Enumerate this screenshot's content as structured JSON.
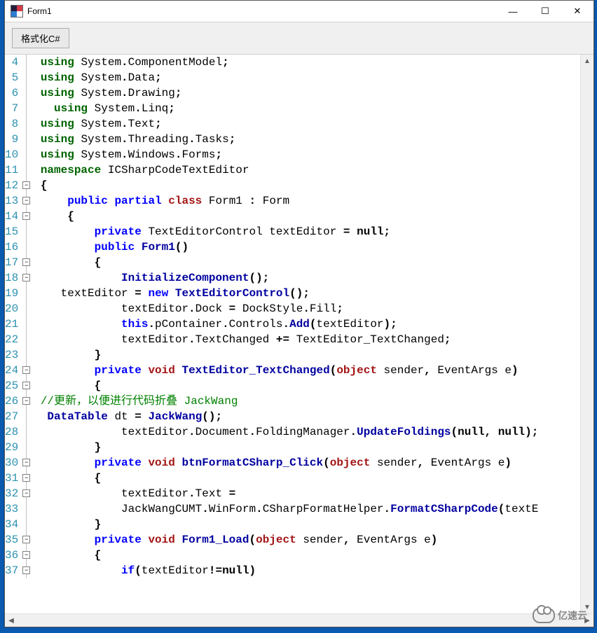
{
  "window": {
    "title": "Form1",
    "controls": {
      "minimize": "—",
      "maximize": "☐",
      "close": "✕"
    }
  },
  "toolbar": {
    "format_button": "格式化C#"
  },
  "editor": {
    "first_line_number": 4,
    "fold_marks": {
      "12": "-",
      "13": "-",
      "14": "-",
      "17": "-",
      "18": "-",
      "24": "-",
      "25": "-",
      "26": "-",
      "30": "-",
      "31": "-",
      "32": "-",
      "35": "-",
      "36": "-",
      "37": "-"
    },
    "lines": [
      {
        "n": 4,
        "t": [
          [
            "kw2",
            "using"
          ],
          [
            "sp",
            " "
          ],
          [
            "id",
            "System"
          ],
          [
            "punct",
            "."
          ],
          [
            "id",
            "ComponentModel"
          ],
          [
            "punct",
            ";"
          ]
        ]
      },
      {
        "n": 5,
        "t": [
          [
            "kw2",
            "using"
          ],
          [
            "sp",
            " "
          ],
          [
            "id",
            "System"
          ],
          [
            "punct",
            "."
          ],
          [
            "id",
            "Data"
          ],
          [
            "punct",
            ";"
          ]
        ]
      },
      {
        "n": 6,
        "t": [
          [
            "kw2",
            "using"
          ],
          [
            "sp",
            " "
          ],
          [
            "id",
            "System"
          ],
          [
            "punct",
            "."
          ],
          [
            "id",
            "Drawing"
          ],
          [
            "punct",
            ";"
          ]
        ]
      },
      {
        "n": 7,
        "t": [
          [
            "sp",
            "  "
          ],
          [
            "kw2",
            "using"
          ],
          [
            "sp",
            " "
          ],
          [
            "id",
            "System"
          ],
          [
            "punct",
            "."
          ],
          [
            "id",
            "Linq"
          ],
          [
            "punct",
            ";"
          ]
        ]
      },
      {
        "n": 8,
        "t": [
          [
            "kw2",
            "using"
          ],
          [
            "sp",
            " "
          ],
          [
            "id",
            "System"
          ],
          [
            "punct",
            "."
          ],
          [
            "id",
            "Text"
          ],
          [
            "punct",
            ";"
          ]
        ]
      },
      {
        "n": 9,
        "t": [
          [
            "kw2",
            "using"
          ],
          [
            "sp",
            " "
          ],
          [
            "id",
            "System"
          ],
          [
            "punct",
            "."
          ],
          [
            "id",
            "Threading"
          ],
          [
            "punct",
            "."
          ],
          [
            "id",
            "Tasks"
          ],
          [
            "punct",
            ";"
          ]
        ]
      },
      {
        "n": 10,
        "t": [
          [
            "kw2",
            "using"
          ],
          [
            "sp",
            " "
          ],
          [
            "id",
            "System"
          ],
          [
            "punct",
            "."
          ],
          [
            "id",
            "Windows"
          ],
          [
            "punct",
            "."
          ],
          [
            "id",
            "Forms"
          ],
          [
            "punct",
            ";"
          ]
        ]
      },
      {
        "n": 11,
        "t": [
          [
            "kw2",
            "namespace"
          ],
          [
            "sp",
            " "
          ],
          [
            "id",
            "ICSharpCodeTextEditor"
          ]
        ]
      },
      {
        "n": 12,
        "t": [
          [
            "punct",
            "{"
          ]
        ]
      },
      {
        "n": 13,
        "t": [
          [
            "sp",
            "    "
          ],
          [
            "kw",
            "public"
          ],
          [
            "sp",
            " "
          ],
          [
            "kw",
            "partial"
          ],
          [
            "sp",
            " "
          ],
          [
            "class",
            "class"
          ],
          [
            "sp",
            " "
          ],
          [
            "id",
            "Form1 "
          ],
          [
            "punct",
            ":"
          ],
          [
            "sp",
            " "
          ],
          [
            "id",
            "Form"
          ]
        ]
      },
      {
        "n": 14,
        "t": [
          [
            "sp",
            "    "
          ],
          [
            "punct",
            "{"
          ]
        ]
      },
      {
        "n": 15,
        "t": [
          [
            "sp",
            "        "
          ],
          [
            "kw",
            "private"
          ],
          [
            "sp",
            " "
          ],
          [
            "id",
            "TextEditorControl textEditor "
          ],
          [
            "punct",
            "="
          ],
          [
            "sp",
            " "
          ],
          [
            "null",
            "null"
          ],
          [
            "punct",
            ";"
          ]
        ]
      },
      {
        "n": 16,
        "t": [
          [
            "sp",
            "        "
          ],
          [
            "kw",
            "public"
          ],
          [
            "sp",
            " "
          ],
          [
            "callB",
            "Form1"
          ],
          [
            "punct",
            "()"
          ]
        ]
      },
      {
        "n": 17,
        "t": [
          [
            "sp",
            "        "
          ],
          [
            "punct",
            "{"
          ]
        ]
      },
      {
        "n": 18,
        "t": [
          [
            "sp",
            "            "
          ],
          [
            "callB",
            "InitializeComponent"
          ],
          [
            "punct",
            "();"
          ]
        ]
      },
      {
        "n": 19,
        "t": [
          [
            "sp",
            "   "
          ],
          [
            "id",
            "textEditor "
          ],
          [
            "punct",
            "="
          ],
          [
            "sp",
            " "
          ],
          [
            "kw",
            "new"
          ],
          [
            "sp",
            " "
          ],
          [
            "callB",
            "TextEditorControl"
          ],
          [
            "punct",
            "();"
          ]
        ]
      },
      {
        "n": 20,
        "t": [
          [
            "sp",
            "            "
          ],
          [
            "id",
            "textEditor"
          ],
          [
            "punct",
            "."
          ],
          [
            "id",
            "Dock "
          ],
          [
            "punct",
            "="
          ],
          [
            "sp",
            " "
          ],
          [
            "id",
            "DockStyle"
          ],
          [
            "punct",
            "."
          ],
          [
            "id",
            "Fill"
          ],
          [
            "punct",
            ";"
          ]
        ]
      },
      {
        "n": 21,
        "t": [
          [
            "sp",
            "            "
          ],
          [
            "kw",
            "this"
          ],
          [
            "punct",
            "."
          ],
          [
            "id",
            "pContainer"
          ],
          [
            "punct",
            "."
          ],
          [
            "id",
            "Controls"
          ],
          [
            "punct",
            "."
          ],
          [
            "callB",
            "Add"
          ],
          [
            "punct",
            "("
          ],
          [
            "id",
            "textEditor"
          ],
          [
            "punct",
            ");"
          ]
        ]
      },
      {
        "n": 22,
        "t": [
          [
            "sp",
            "            "
          ],
          [
            "id",
            "textEditor"
          ],
          [
            "punct",
            "."
          ],
          [
            "id",
            "TextChanged "
          ],
          [
            "punct",
            "+="
          ],
          [
            "sp",
            " "
          ],
          [
            "id",
            "TextEditor_TextChanged"
          ],
          [
            "punct",
            ";"
          ]
        ]
      },
      {
        "n": 23,
        "t": [
          [
            "sp",
            "        "
          ],
          [
            "punct",
            "}"
          ]
        ]
      },
      {
        "n": 24,
        "t": [
          [
            "sp",
            "        "
          ],
          [
            "kw",
            "private"
          ],
          [
            "sp",
            " "
          ],
          [
            "class",
            "void"
          ],
          [
            "sp",
            " "
          ],
          [
            "callB",
            "TextEditor_TextChanged"
          ],
          [
            "punct",
            "("
          ],
          [
            "class",
            "object"
          ],
          [
            "sp",
            " "
          ],
          [
            "id",
            "sender"
          ],
          [
            "punct",
            ","
          ],
          [
            "sp",
            " "
          ],
          [
            "id",
            "EventArgs e"
          ],
          [
            "punct",
            ")"
          ]
        ]
      },
      {
        "n": 25,
        "t": [
          [
            "sp",
            "        "
          ],
          [
            "punct",
            "{"
          ]
        ]
      },
      {
        "n": 26,
        "t": [
          [
            "comment",
            "//更新，以便进行代码折叠 JackWang"
          ]
        ]
      },
      {
        "n": 27,
        "t": [
          [
            "sp",
            " "
          ],
          [
            "callB",
            "DataTable"
          ],
          [
            "sp",
            " "
          ],
          [
            "id",
            "dt "
          ],
          [
            "punct",
            "="
          ],
          [
            "sp",
            " "
          ],
          [
            "callB",
            "JackWang"
          ],
          [
            "punct",
            "();"
          ]
        ]
      },
      {
        "n": 28,
        "t": [
          [
            "sp",
            "            "
          ],
          [
            "id",
            "textEditor"
          ],
          [
            "punct",
            "."
          ],
          [
            "id",
            "Document"
          ],
          [
            "punct",
            "."
          ],
          [
            "id",
            "FoldingManager"
          ],
          [
            "punct",
            "."
          ],
          [
            "callB",
            "UpdateFoldings"
          ],
          [
            "punct",
            "("
          ],
          [
            "null",
            "null"
          ],
          [
            "punct",
            ", "
          ],
          [
            "null",
            "null"
          ],
          [
            "punct",
            ");"
          ]
        ]
      },
      {
        "n": 29,
        "t": [
          [
            "sp",
            "        "
          ],
          [
            "punct",
            "}"
          ]
        ]
      },
      {
        "n": 30,
        "t": [
          [
            "sp",
            "        "
          ],
          [
            "kw",
            "private"
          ],
          [
            "sp",
            " "
          ],
          [
            "class",
            "void"
          ],
          [
            "sp",
            " "
          ],
          [
            "callB",
            "btnFormatCSharp_Click"
          ],
          [
            "punct",
            "("
          ],
          [
            "class",
            "object"
          ],
          [
            "sp",
            " "
          ],
          [
            "id",
            "sender"
          ],
          [
            "punct",
            ","
          ],
          [
            "sp",
            " "
          ],
          [
            "id",
            "EventArgs e"
          ],
          [
            "punct",
            ")"
          ]
        ]
      },
      {
        "n": 31,
        "t": [
          [
            "sp",
            "        "
          ],
          [
            "punct",
            "{"
          ]
        ]
      },
      {
        "n": 32,
        "t": [
          [
            "sp",
            "            "
          ],
          [
            "id",
            "textEditor"
          ],
          [
            "punct",
            "."
          ],
          [
            "id",
            "Text "
          ],
          [
            "punct",
            "="
          ]
        ]
      },
      {
        "n": 33,
        "t": [
          [
            "sp",
            "            "
          ],
          [
            "id",
            "JackWangCUMT"
          ],
          [
            "punct",
            "."
          ],
          [
            "id",
            "WinForm"
          ],
          [
            "punct",
            "."
          ],
          [
            "id",
            "CSharpFormatHelper"
          ],
          [
            "punct",
            "."
          ],
          [
            "callB",
            "FormatCSharpCode"
          ],
          [
            "punct",
            "("
          ],
          [
            "id",
            "textE"
          ]
        ]
      },
      {
        "n": 34,
        "t": [
          [
            "sp",
            "        "
          ],
          [
            "punct",
            "}"
          ]
        ]
      },
      {
        "n": 35,
        "t": [
          [
            "sp",
            "        "
          ],
          [
            "kw",
            "private"
          ],
          [
            "sp",
            " "
          ],
          [
            "class",
            "void"
          ],
          [
            "sp",
            " "
          ],
          [
            "callB",
            "Form1_Load"
          ],
          [
            "punct",
            "("
          ],
          [
            "class",
            "object"
          ],
          [
            "sp",
            " "
          ],
          [
            "id",
            "sender"
          ],
          [
            "punct",
            ","
          ],
          [
            "sp",
            " "
          ],
          [
            "id",
            "EventArgs e"
          ],
          [
            "punct",
            ")"
          ]
        ]
      },
      {
        "n": 36,
        "t": [
          [
            "sp",
            "        "
          ],
          [
            "punct",
            "{"
          ]
        ]
      },
      {
        "n": 37,
        "t": [
          [
            "sp",
            "            "
          ],
          [
            "kw",
            "if"
          ],
          [
            "punct",
            "("
          ],
          [
            "id",
            "textEditor"
          ],
          [
            "punct",
            "!="
          ],
          [
            "null",
            "null"
          ],
          [
            "punct",
            ")"
          ]
        ]
      }
    ]
  },
  "watermark": "亿速云"
}
